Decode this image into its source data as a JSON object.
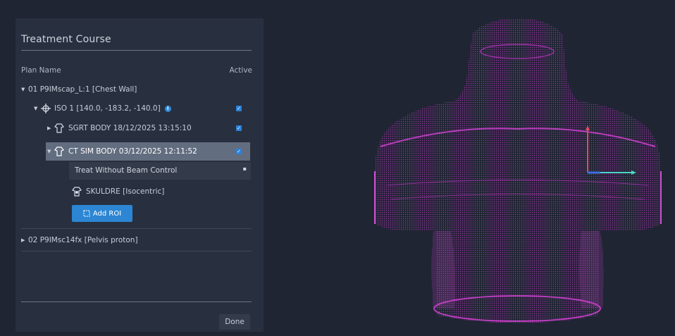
{
  "panel": {
    "title": "Treatment Course",
    "col_plan_name": "Plan Name",
    "col_active": "Active",
    "plan1": "01 P9IMscap_L:1 [Chest Wall]",
    "iso": "ISO 1 [140.0, -183.2, -140.0]",
    "sgrt": "SGRT BODY 18/12/2025 13:15:10",
    "ctsim": "CT SIM BODY 03/12/2025 12:11:52",
    "beam_control": "Treat Without Beam Control",
    "structure": "SKULDRE [Isocentric]",
    "add_roi": "Add ROI",
    "plan2": "02 P9IMsc14fx [Pelvis proton]",
    "done": "Done"
  },
  "checkboxes": {
    "iso_active": true,
    "sgrt_active": true,
    "ctsim_active": true
  },
  "colors": {
    "accent": "#2c86d3",
    "pointcloud": "#b235b8",
    "axis_x": "#4fd6c8",
    "axis_y": "#e8476a",
    "axis_z": "#3b6fe0",
    "panel": "#283040",
    "background": "#1f2533"
  },
  "icons": [
    "caret-down-icon",
    "caret-right-icon",
    "isocenter-crosshair-icon",
    "info-icon",
    "body-outline-icon",
    "structure-icon",
    "add-roi-icon",
    "dropdown-arrow-icon",
    "checkmark-icon"
  ]
}
